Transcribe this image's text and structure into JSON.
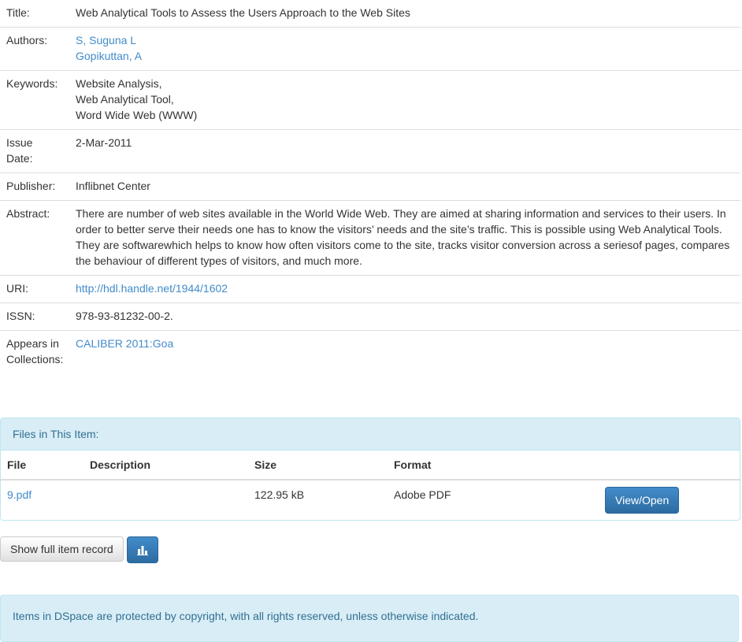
{
  "record": {
    "title_label": "Title:",
    "title": "Web Analytical Tools to Assess the Users Approach to the Web Sites",
    "authors_label": "Authors:",
    "authors": [
      "S, Suguna L",
      "Gopikuttan, A"
    ],
    "keywords_label": "Keywords:",
    "keywords": [
      "Website Analysis,",
      "Web Analytical Tool,",
      "Word Wide Web (WWW)"
    ],
    "issue_date_label_1": "Issue",
    "issue_date_label_2": "Date:",
    "issue_date": "2-Mar-2011",
    "publisher_label": "Publisher:",
    "publisher": "Inflibnet Center",
    "abstract_label": "Abstract:",
    "abstract_lines": [
      "There are number of web sites available in the World Wide Web. They are aimed at sharing information and services to their users. In",
      "order to better serve their needs one has to know the visitors’ needs and the site’s traffic. This is possible using Web Analytical Tools.",
      "They are softwarewhich helps to know how often visitors come to the site, tracks visitor conversion across a seriesof pages, compares",
      "the behaviour of different types of visitors, and much more."
    ],
    "uri_label": "URI:",
    "uri": "http://hdl.handle.net/1944/1602",
    "issn_label": "ISSN:",
    "issn": "978-93-81232-00-2.",
    "collections_label_1": "Appears in",
    "collections_label_2": "Collections:",
    "collection": "CALIBER 2011:Goa"
  },
  "files_panel": {
    "heading": "Files in This Item:",
    "columns": [
      "File",
      "Description",
      "Size",
      "Format"
    ],
    "rows": [
      {
        "file": "9.pdf",
        "description": "",
        "size": "122.95 kB",
        "format": "Adobe PDF",
        "action": "View/Open"
      }
    ]
  },
  "actions": {
    "show_full_record": "Show full item record",
    "stats_icon": "bar-chart-icon"
  },
  "footer": {
    "notice": "Items in DSpace are protected by copyright, with all rights reserved, unless otherwise indicated."
  },
  "colors": {
    "link": "#428bca",
    "info_bg": "#d9edf7",
    "info_text": "#31708f",
    "primary": "#337ab7"
  }
}
